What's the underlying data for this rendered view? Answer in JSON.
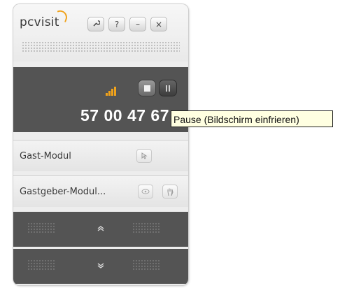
{
  "app": {
    "logo_text": "pcvisit",
    "header_buttons": [
      {
        "name": "wrench-button",
        "icon": "wrench-icon",
        "glyph": "🔧"
      },
      {
        "name": "help-button",
        "icon": "question-icon",
        "glyph": "?"
      },
      {
        "name": "minimize-button",
        "icon": "minimize-icon",
        "glyph": "–"
      },
      {
        "name": "close-button",
        "icon": "close-icon",
        "glyph": "×"
      }
    ]
  },
  "session": {
    "id": "57 00 47 67",
    "signal_icon": "signal-strength-icon",
    "stop_icon": "stop-icon",
    "pause_icon": "pause-icon"
  },
  "tooltip": {
    "text": "Pause (Bildschirm einfrieren)"
  },
  "modules": [
    {
      "label": "Gast-Modul",
      "icons": [
        "cursor-icon"
      ]
    },
    {
      "label": "Gastgeber-Modul...",
      "icons": [
        "eye-icon",
        "hand-icon"
      ]
    }
  ],
  "scroll": {
    "up_icon": "chevron-up-icon",
    "down_icon": "chevron-down-icon"
  },
  "colors": {
    "accent": "#f0a21b",
    "dark_panel": "#545454",
    "tooltip_bg": "#ffffe1"
  }
}
